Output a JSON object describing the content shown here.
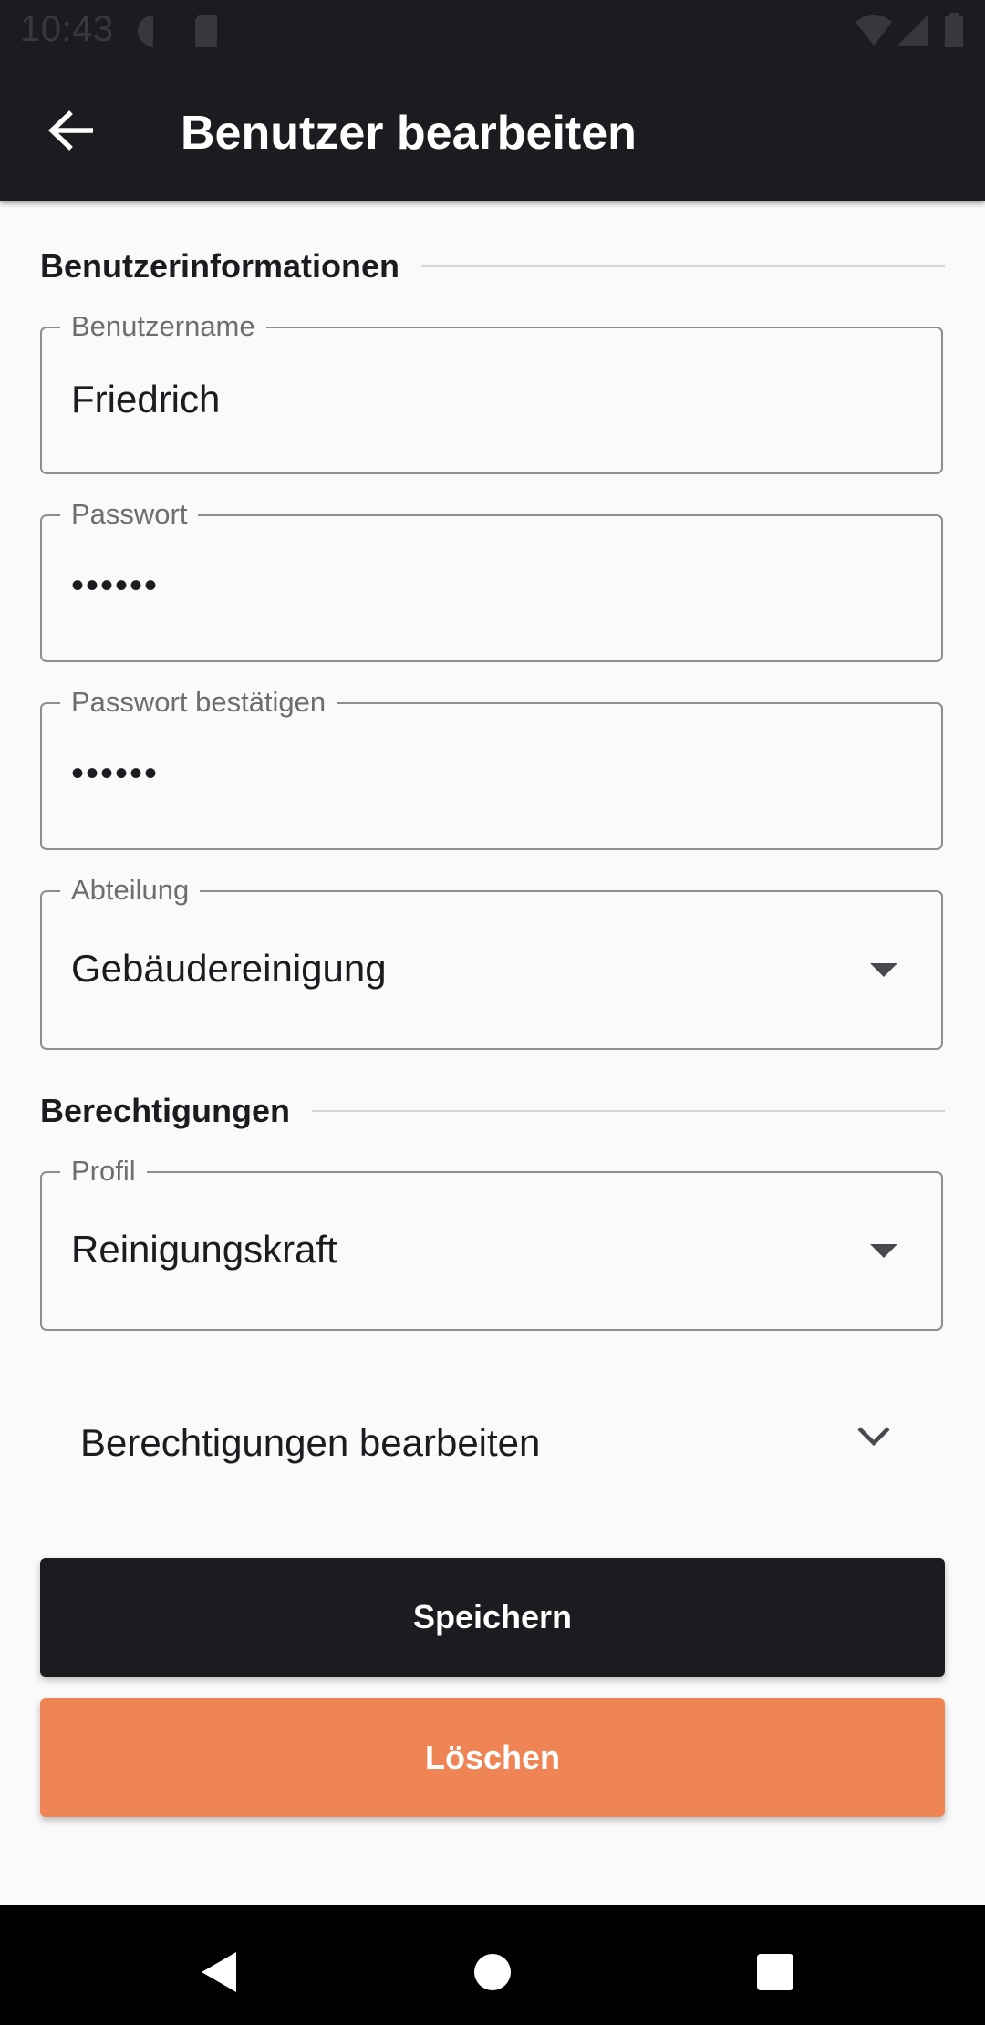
{
  "status_bar": {
    "time": "10:43",
    "icons": [
      "cast-icon",
      "sd-card-icon",
      "wifi-icon",
      "signal-icon",
      "battery-icon"
    ]
  },
  "app_bar": {
    "title": "Benutzer bearbeiten",
    "back_icon": "arrow-back-icon"
  },
  "user_info_section": {
    "title": "Benutzerinformationen",
    "fields": [
      {
        "label": "Benutzername",
        "value": "Friedrich"
      },
      {
        "label": "Passwort",
        "value": "••••••"
      },
      {
        "label": "Passwort bestätigen",
        "value": "••••••"
      },
      {
        "label": "Abteilung",
        "value": "Gebäudereinigung"
      }
    ]
  },
  "permissions_section": {
    "title": "Berechtigungen",
    "profile": {
      "label": "Profil",
      "value": "Reinigungskraft"
    },
    "expand_label": "Berechtigungen bearbeiten"
  },
  "actions": {
    "save_label": "Speichern",
    "delete_label": "Löschen"
  },
  "colors": {
    "app_bar": "#1d1b20",
    "background": "#fafafa",
    "save_button": "#1d1b20",
    "delete_button": "#ef8454"
  },
  "nav_bar": {
    "icons": [
      "back-triangle-icon",
      "home-circle-icon",
      "recents-square-icon"
    ]
  }
}
